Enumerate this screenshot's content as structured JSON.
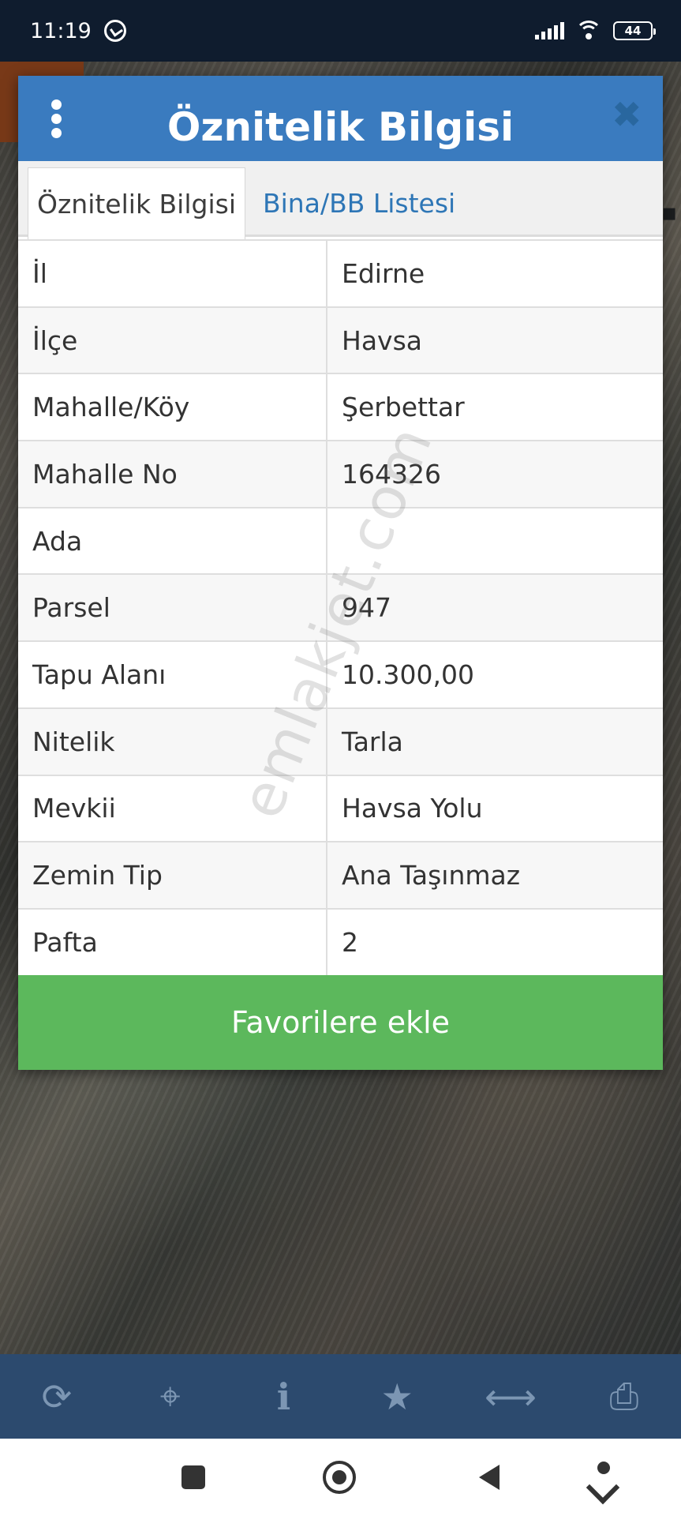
{
  "status_bar": {
    "time": "11:19",
    "battery": "44"
  },
  "dialog": {
    "title": "Öznitelik Bilgisi",
    "tabs": [
      {
        "label": "Öznitelik Bilgisi",
        "active": true
      },
      {
        "label": "Bina/BB Listesi",
        "active": false
      }
    ],
    "rows": [
      {
        "key": "İl",
        "value": "Edirne"
      },
      {
        "key": "İlçe",
        "value": "Havsa"
      },
      {
        "key": "Mahalle/Köy",
        "value": "Şerbettar"
      },
      {
        "key": "Mahalle No",
        "value": "164326"
      },
      {
        "key": "Ada",
        "value": ""
      },
      {
        "key": "Parsel",
        "value": "947"
      },
      {
        "key": "Tapu Alanı",
        "value": "10.300,00"
      },
      {
        "key": "Nitelik",
        "value": "Tarla"
      },
      {
        "key": "Mevkii",
        "value": "Havsa Yolu"
      },
      {
        "key": "Zemin Tip",
        "value": "Ana Taşınmaz"
      },
      {
        "key": "Pafta",
        "value": "2"
      }
    ],
    "favorite_button": "Favorilere ekle"
  },
  "watermark": "emlakjet.com",
  "toolbar": {
    "icons": [
      "refresh-icon",
      "crosshair-icon",
      "info-icon",
      "star-icon",
      "measure-icon",
      "print-icon"
    ]
  },
  "colors": {
    "header": "#3a7bbf",
    "button": "#5cb85c",
    "toolbar": "#2c4a6e",
    "status_bar": "#0f1c2e"
  }
}
